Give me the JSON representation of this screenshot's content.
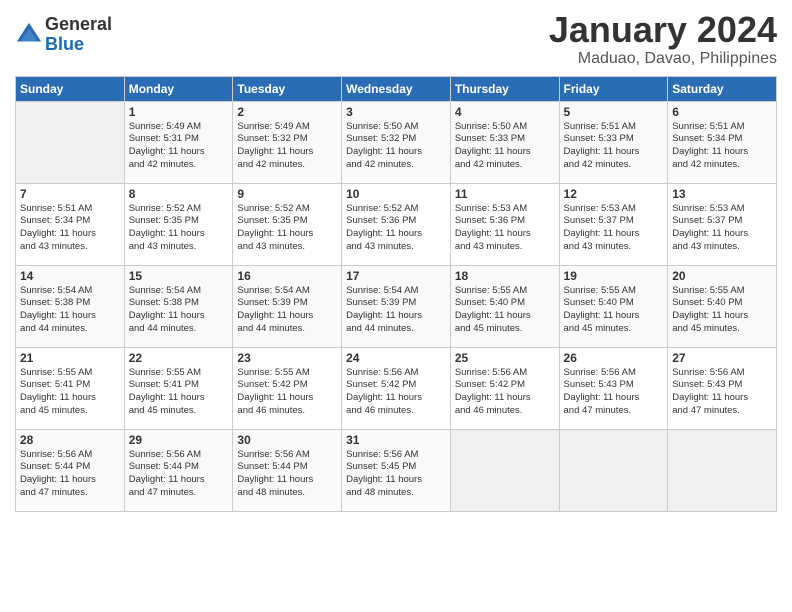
{
  "header": {
    "logo_line1": "General",
    "logo_line2": "Blue",
    "month": "January 2024",
    "location": "Maduao, Davao, Philippines"
  },
  "weekdays": [
    "Sunday",
    "Monday",
    "Tuesday",
    "Wednesday",
    "Thursday",
    "Friday",
    "Saturday"
  ],
  "weeks": [
    [
      {
        "day": "",
        "info": ""
      },
      {
        "day": "1",
        "info": "Sunrise: 5:49 AM\nSunset: 5:31 PM\nDaylight: 11 hours\nand 42 minutes."
      },
      {
        "day": "2",
        "info": "Sunrise: 5:49 AM\nSunset: 5:32 PM\nDaylight: 11 hours\nand 42 minutes."
      },
      {
        "day": "3",
        "info": "Sunrise: 5:50 AM\nSunset: 5:32 PM\nDaylight: 11 hours\nand 42 minutes."
      },
      {
        "day": "4",
        "info": "Sunrise: 5:50 AM\nSunset: 5:33 PM\nDaylight: 11 hours\nand 42 minutes."
      },
      {
        "day": "5",
        "info": "Sunrise: 5:51 AM\nSunset: 5:33 PM\nDaylight: 11 hours\nand 42 minutes."
      },
      {
        "day": "6",
        "info": "Sunrise: 5:51 AM\nSunset: 5:34 PM\nDaylight: 11 hours\nand 42 minutes."
      }
    ],
    [
      {
        "day": "7",
        "info": "Sunrise: 5:51 AM\nSunset: 5:34 PM\nDaylight: 11 hours\nand 43 minutes."
      },
      {
        "day": "8",
        "info": "Sunrise: 5:52 AM\nSunset: 5:35 PM\nDaylight: 11 hours\nand 43 minutes."
      },
      {
        "day": "9",
        "info": "Sunrise: 5:52 AM\nSunset: 5:35 PM\nDaylight: 11 hours\nand 43 minutes."
      },
      {
        "day": "10",
        "info": "Sunrise: 5:52 AM\nSunset: 5:36 PM\nDaylight: 11 hours\nand 43 minutes."
      },
      {
        "day": "11",
        "info": "Sunrise: 5:53 AM\nSunset: 5:36 PM\nDaylight: 11 hours\nand 43 minutes."
      },
      {
        "day": "12",
        "info": "Sunrise: 5:53 AM\nSunset: 5:37 PM\nDaylight: 11 hours\nand 43 minutes."
      },
      {
        "day": "13",
        "info": "Sunrise: 5:53 AM\nSunset: 5:37 PM\nDaylight: 11 hours\nand 43 minutes."
      }
    ],
    [
      {
        "day": "14",
        "info": "Sunrise: 5:54 AM\nSunset: 5:38 PM\nDaylight: 11 hours\nand 44 minutes."
      },
      {
        "day": "15",
        "info": "Sunrise: 5:54 AM\nSunset: 5:38 PM\nDaylight: 11 hours\nand 44 minutes."
      },
      {
        "day": "16",
        "info": "Sunrise: 5:54 AM\nSunset: 5:39 PM\nDaylight: 11 hours\nand 44 minutes."
      },
      {
        "day": "17",
        "info": "Sunrise: 5:54 AM\nSunset: 5:39 PM\nDaylight: 11 hours\nand 44 minutes."
      },
      {
        "day": "18",
        "info": "Sunrise: 5:55 AM\nSunset: 5:40 PM\nDaylight: 11 hours\nand 45 minutes."
      },
      {
        "day": "19",
        "info": "Sunrise: 5:55 AM\nSunset: 5:40 PM\nDaylight: 11 hours\nand 45 minutes."
      },
      {
        "day": "20",
        "info": "Sunrise: 5:55 AM\nSunset: 5:40 PM\nDaylight: 11 hours\nand 45 minutes."
      }
    ],
    [
      {
        "day": "21",
        "info": "Sunrise: 5:55 AM\nSunset: 5:41 PM\nDaylight: 11 hours\nand 45 minutes."
      },
      {
        "day": "22",
        "info": "Sunrise: 5:55 AM\nSunset: 5:41 PM\nDaylight: 11 hours\nand 45 minutes."
      },
      {
        "day": "23",
        "info": "Sunrise: 5:55 AM\nSunset: 5:42 PM\nDaylight: 11 hours\nand 46 minutes."
      },
      {
        "day": "24",
        "info": "Sunrise: 5:56 AM\nSunset: 5:42 PM\nDaylight: 11 hours\nand 46 minutes."
      },
      {
        "day": "25",
        "info": "Sunrise: 5:56 AM\nSunset: 5:42 PM\nDaylight: 11 hours\nand 46 minutes."
      },
      {
        "day": "26",
        "info": "Sunrise: 5:56 AM\nSunset: 5:43 PM\nDaylight: 11 hours\nand 47 minutes."
      },
      {
        "day": "27",
        "info": "Sunrise: 5:56 AM\nSunset: 5:43 PM\nDaylight: 11 hours\nand 47 minutes."
      }
    ],
    [
      {
        "day": "28",
        "info": "Sunrise: 5:56 AM\nSunset: 5:44 PM\nDaylight: 11 hours\nand 47 minutes."
      },
      {
        "day": "29",
        "info": "Sunrise: 5:56 AM\nSunset: 5:44 PM\nDaylight: 11 hours\nand 47 minutes."
      },
      {
        "day": "30",
        "info": "Sunrise: 5:56 AM\nSunset: 5:44 PM\nDaylight: 11 hours\nand 48 minutes."
      },
      {
        "day": "31",
        "info": "Sunrise: 5:56 AM\nSunset: 5:45 PM\nDaylight: 11 hours\nand 48 minutes."
      },
      {
        "day": "",
        "info": ""
      },
      {
        "day": "",
        "info": ""
      },
      {
        "day": "",
        "info": ""
      }
    ]
  ]
}
